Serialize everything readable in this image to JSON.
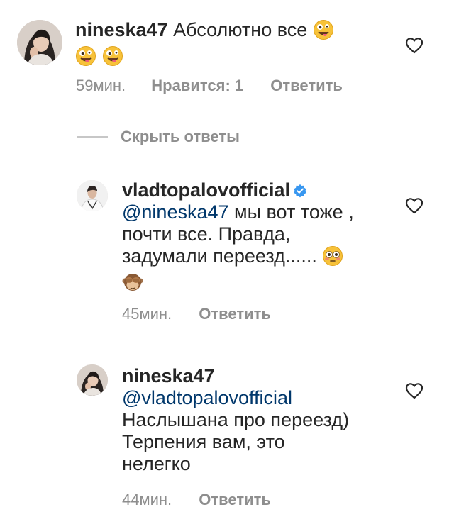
{
  "comments": [
    {
      "username": "nineska47",
      "text": "Абсолютно все",
      "time": "59мин.",
      "likes": "Нравится: 1",
      "reply": "Ответить",
      "avatar_icon": "user-avatar-photo",
      "emoji_icons": [
        "zany-face-emoji",
        "zany-face-emoji",
        "zany-face-emoji"
      ]
    }
  ],
  "hide_replies": "Скрыть ответы",
  "replies": [
    {
      "username": "vladtopalovofficial",
      "verified": true,
      "mention": "@nineska47",
      "text_line1": "мы вот тоже ,",
      "text_line2": "почти все. Правда,",
      "text_line3": "задумали переезд......",
      "time": "45мин.",
      "reply": "Ответить",
      "avatar_icon": "user-avatar-photo",
      "emoji_icons": [
        "flushed-face-emoji",
        "see-no-evil-monkey-emoji"
      ]
    },
    {
      "username": "nineska47",
      "mention": "@vladtopalovofficial",
      "text_line1": "Наслышана про переезд)",
      "text_line2": "Терпения вам, это",
      "text_line3": "нелегко",
      "time": "44мин.",
      "reply": "Ответить",
      "avatar_icon": "user-avatar-photo"
    }
  ],
  "colors": {
    "text": "#262626",
    "secondary": "#8e8e8e",
    "mention": "#00376b",
    "verified": "#3897f0"
  }
}
